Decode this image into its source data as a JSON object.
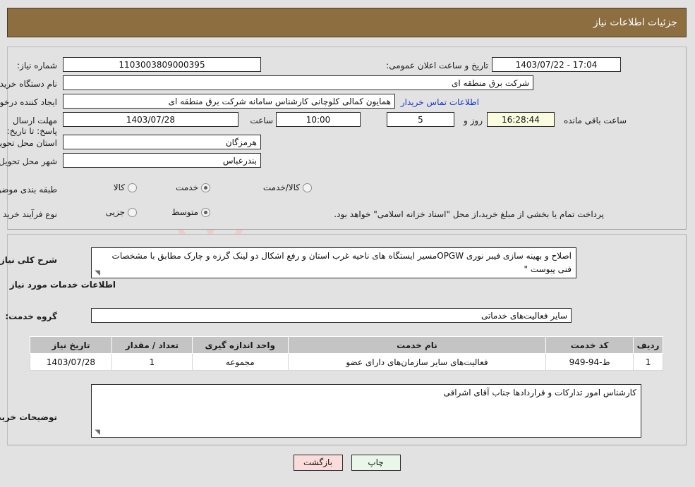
{
  "header": {
    "title": "جزئیات اطلاعات نیاز"
  },
  "fields": {
    "need_number_label": "شماره نیاز:",
    "need_number_value": "1103003809000395",
    "public_announce_label": "تاریخ و ساعت اعلان عمومی:",
    "public_announce_value": "17:04 - 1403/07/22",
    "buyer_org_label": "نام دستگاه خریدار:",
    "buyer_org_value": "شرکت برق منطقه ای",
    "requester_label": "ایجاد کننده درخواست:",
    "requester_value": "همایون کمالی کلوچانی کارشناس سامانه شرکت برق منطقه ای",
    "contact_link": "اطلاعات تماس خریدار",
    "deadline_label": "مهلت ارسال پاسخ: تا تاریخ:",
    "deadline_date": "1403/07/28",
    "hour_label": "ساعت",
    "hour_value": "10:00",
    "days_value": "5",
    "days_label": "روز و",
    "countdown_value": "16:28:44",
    "countdown_label": "ساعت باقی مانده",
    "province_label": "استان محل تحویل:",
    "province_value": "هرمزگان",
    "city_label": "شهر محل تحویل:",
    "city_value": "بندرعباس",
    "category_label": "طبقه بندی موضوعی:",
    "purchase_type_label": "نوع فرآیند خرید :",
    "islamic_note": "پرداخت تمام یا بخشی از مبلغ خرید،از محل \"اسناد خزانه اسلامی\" خواهد بود."
  },
  "category_options": [
    {
      "label": "کالا",
      "selected": false
    },
    {
      "label": "خدمت",
      "selected": true
    },
    {
      "label": "کالا/خدمت",
      "selected": false
    }
  ],
  "purchase_options": [
    {
      "label": "جزیی",
      "selected": false
    },
    {
      "label": "متوسط",
      "selected": true
    }
  ],
  "description": {
    "label": "شرح کلی نیاز:",
    "value": "اصلاح و بهینه سازی فیبر نوری OPGWمسیر ایستگاه های ناحیه غرب استان و رفع اشکال دو لینک گرزه و چارک مطابق با مشخصات فنی  پیوست \""
  },
  "services_section": {
    "heading": "اطلاعات خدمات مورد نیاز",
    "group_label": "گروه خدمت:",
    "group_value": "سایر فعالیت‌های خدماتی"
  },
  "table": {
    "columns": [
      "ردیف",
      "کد خدمت",
      "نام خدمت",
      "واحد اندازه گیری",
      "تعداد / مقدار",
      "تاریخ نیاز"
    ],
    "rows": [
      {
        "row": "1",
        "code": "ط-94-949",
        "name": "فعالیت‌های سایر سازمان‌های دارای عضو",
        "unit": "مجموعه",
        "qty": "1",
        "date": "1403/07/28"
      }
    ]
  },
  "buyer_notes": {
    "label": "توضیحات خریدار:",
    "value": "کارشناس امور تدارکات و قراردادها جناب آقای اشراقی"
  },
  "buttons": {
    "print": "چاپ",
    "back": "بازگشت"
  },
  "watermark": {
    "text": "ArtaTender.net"
  },
  "colors": {
    "header_bg": "#8c6e41",
    "page_bg": "#e2e2e2",
    "link": "#1538c9",
    "table_header_bg": "#c4c4c4",
    "print_btn_bg": "#e9f6e9",
    "back_btn_bg": "#fbdcdc",
    "countdown_bg": "#fbfbe0"
  }
}
